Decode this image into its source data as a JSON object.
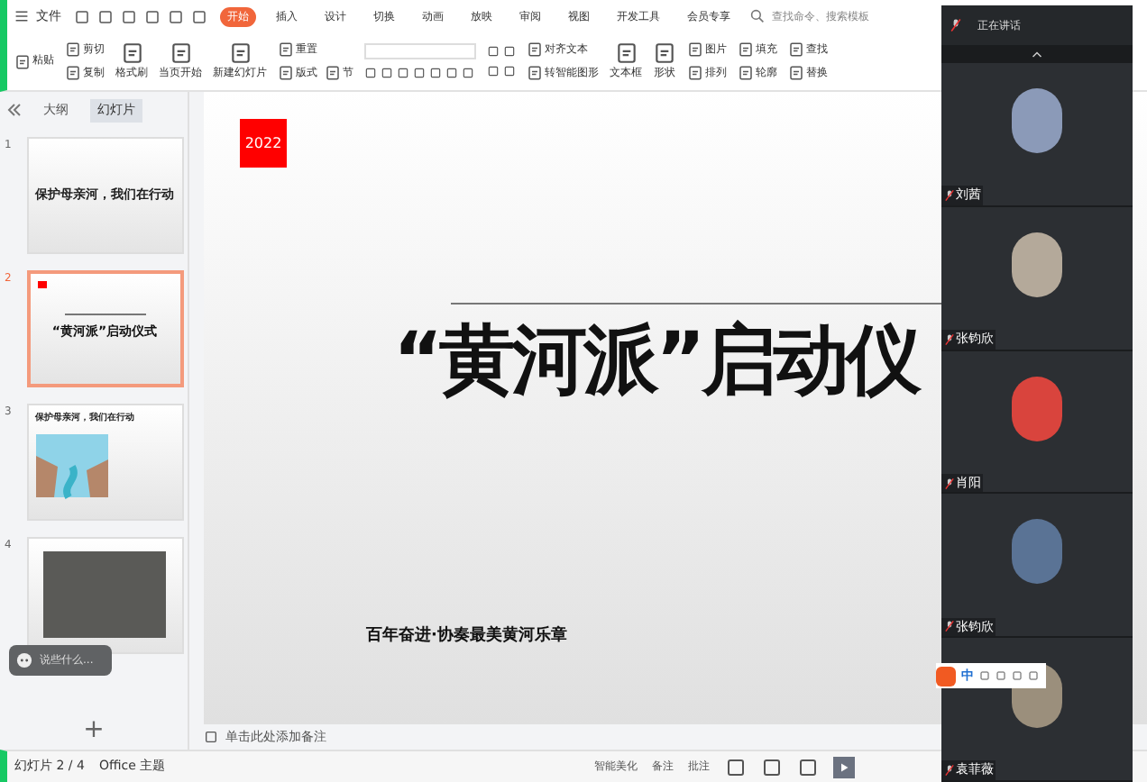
{
  "menu": {
    "file": "文件",
    "tabs": [
      {
        "label": "开始",
        "selected": true
      },
      {
        "label": "插入",
        "selected": false
      },
      {
        "label": "设计",
        "selected": false
      },
      {
        "label": "切换",
        "selected": false
      },
      {
        "label": "动画",
        "selected": false
      },
      {
        "label": "放映",
        "selected": false
      },
      {
        "label": "审阅",
        "selected": false
      },
      {
        "label": "视图",
        "selected": false
      },
      {
        "label": "开发工具",
        "selected": false
      },
      {
        "label": "会员专享",
        "selected": false
      }
    ],
    "search": {
      "placeholder": "查找命令、搜索模板"
    }
  },
  "ribbon": {
    "paste": "粘贴",
    "cut": "剪切",
    "copy": "复制",
    "format_painter": "格式刷",
    "play_from_current": "当页开始",
    "new_slide": "新建幻灯片",
    "layout": "版式",
    "section": "节",
    "reset": "重置",
    "align_text": "对齐文本",
    "smartart": "转智能图形",
    "textbox": "文本框",
    "shapes": "形状",
    "picture": "图片",
    "arrange": "排列",
    "fill": "填充",
    "outline": "轮廓",
    "find": "查找",
    "replace": "替换"
  },
  "side_panel": {
    "tabs": [
      {
        "label": "大纲",
        "selected": false
      },
      {
        "label": "幻灯片",
        "selected": true
      }
    ],
    "slides": [
      {
        "number": "1",
        "kind": "title",
        "title": "保护母亲河，我们在行动",
        "selected": false
      },
      {
        "number": "2",
        "kind": "ceremony",
        "title": "“黄河派”启动仪式",
        "selected": true
      },
      {
        "number": "3",
        "kind": "illustration",
        "title": "保护母亲河，我们在行动",
        "selected": false
      },
      {
        "number": "4",
        "kind": "photo",
        "selected": false
      }
    ],
    "chat_prompt": "说些什么...",
    "add": "+"
  },
  "slide": {
    "badge": "2022",
    "title": "“黄河派”启动仪",
    "subtitle": "百年奋进·协奏最美黄河乐章"
  },
  "notes": {
    "placeholder": "单击此处添加备注"
  },
  "status_bar": {
    "slide_counter": "幻灯片 2 / 4",
    "theme": "Office 主题",
    "beautify": "智能美化",
    "notes": "备注",
    "comments": "批注"
  },
  "meeting": {
    "speaking": "正在讲话",
    "participants": [
      {
        "name": "刘茜",
        "muted": true
      },
      {
        "name": "张钧欣",
        "muted": true
      },
      {
        "name": "肖阳",
        "muted": true
      },
      {
        "name": "张钧欣",
        "muted": true
      },
      {
        "name": "袁菲薇",
        "muted": true
      }
    ]
  },
  "ime": {
    "mode": "中"
  }
}
